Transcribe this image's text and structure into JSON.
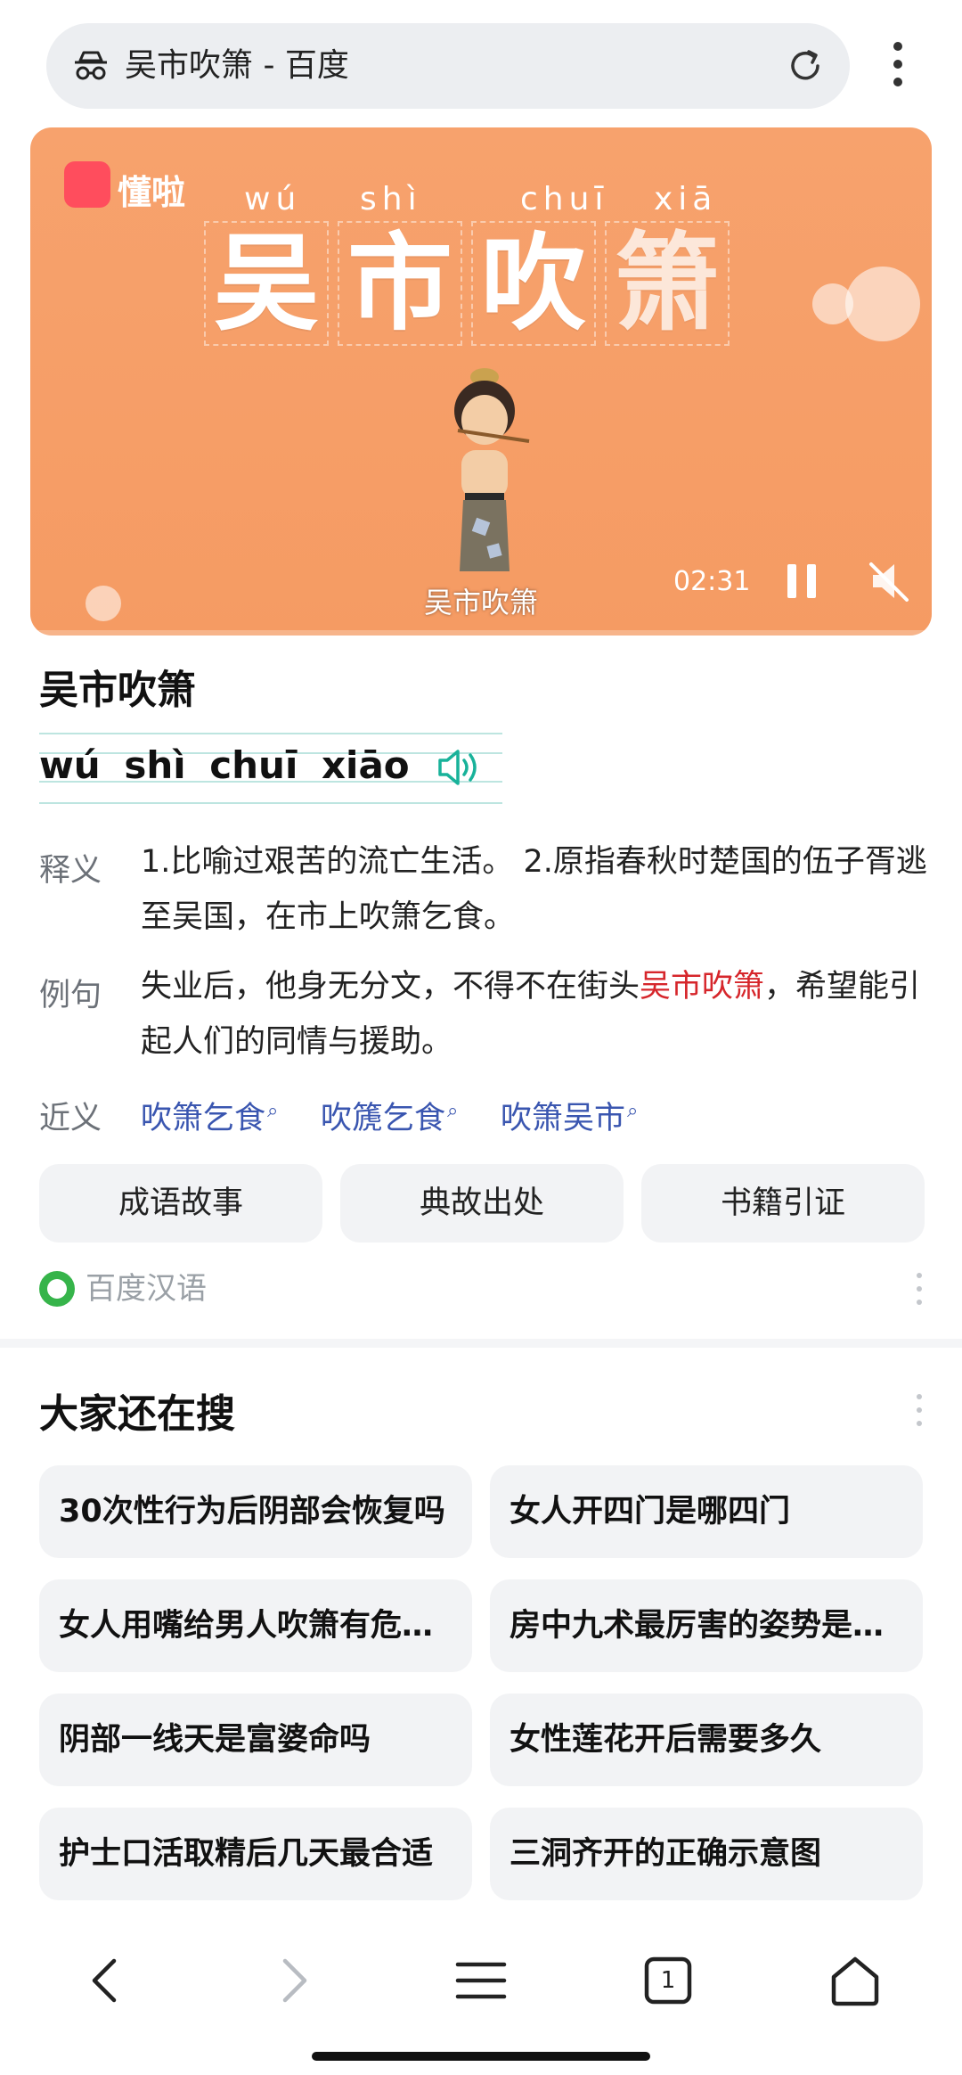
{
  "address_bar": {
    "title": "吴市吹箫 - 百度"
  },
  "video": {
    "brand": "懂啦",
    "pinyin": [
      "wú",
      "shì",
      "chuī",
      "xiā"
    ],
    "title_chars": [
      "吴",
      "市",
      "吹",
      "箫"
    ],
    "caption": "吴市吹箫",
    "time": "02:31"
  },
  "idiom": {
    "title": "吴市吹箫",
    "pinyin": "wú shì chuī xiāo",
    "meaning_label": "释义",
    "meaning_text": "1.比喻过艰苦的流亡生活。 2.原指春秋时楚国的伍子胥逃至吴国，在市上吹箫乞食。",
    "example_label": "例句",
    "example_pre": "失业后，他身无分文，不得不在街头",
    "example_highlight": "吴市吹箫",
    "example_post": "，希望能引起人们的同情与援助。",
    "synonym_label": "近义",
    "synonyms": [
      "吹箫乞食",
      "吹篪乞食",
      "吹箫吴市"
    ],
    "tabs": [
      "成语故事",
      "典故出处",
      "书籍引证"
    ],
    "source": "百度汉语"
  },
  "related_searches": {
    "title": "大家还在搜",
    "items": [
      "30次性行为后阴部会恢复吗",
      "女人开四门是哪四门",
      "女人用嘴给男人吹箫有危害吗",
      "房中九术最厉害的姿势是哪个",
      "阴部一线天是富婆命吗",
      "女性莲花开后需要多久",
      "护士口活取精后几天最合适",
      "三洞齐开的正确示意图"
    ]
  },
  "bottom_nav": {
    "tab_count": "1"
  },
  "colors": {
    "video_bg": "#f59b63",
    "link": "#3a56b0",
    "highlight": "#d6262b",
    "speaker": "#18b29a"
  }
}
